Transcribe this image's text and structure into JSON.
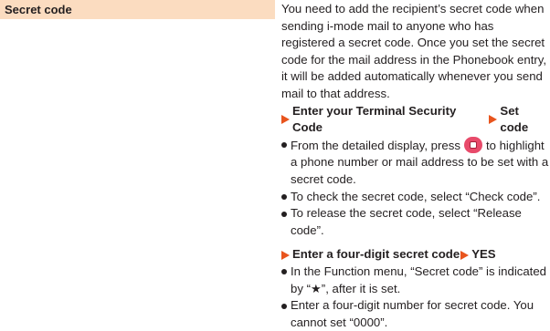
{
  "term": {
    "label": "Secret code"
  },
  "description": {
    "intro": "You need to add the recipient’s secret code when sending i-mode mail to anyone who has registered a secret code. Once you set the secret code for the mail address in the Phonebook entry, it will be added automatically whenever you send mail to that address.",
    "step1": {
      "part1": "Enter your Terminal Security Code",
      "part2": "Set code"
    },
    "bullets1": {
      "b1_before": "From the detailed display, press",
      "b1_after": "to highlight a phone number or mail address to be set with a secret code.",
      "b2": "To check the secret code, select “Check code”.",
      "b3": "To release the secret code, select “Release code”."
    },
    "step2": {
      "part1": "Enter a four-digit secret code",
      "part2": "YES"
    },
    "bullets2": {
      "b1": "In the Function menu, “Secret code” is indicated by “★”, after it is set.",
      "b2": "Enter a four-digit number for secret code. You cannot set “0000”."
    }
  },
  "icons": {
    "step_arrow": "right-triangle-icon",
    "nav_key": "multi-cursor-key-icon"
  },
  "colors": {
    "term_background": "#fbdcc0",
    "step_arrow": "#e8541d",
    "nav_key": "#e84a6a",
    "text": "#231f20"
  }
}
